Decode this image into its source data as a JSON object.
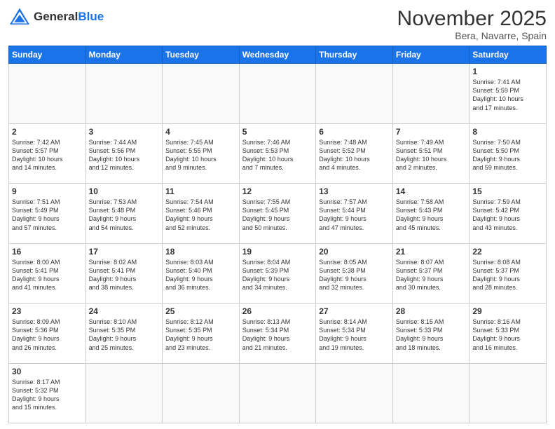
{
  "header": {
    "logo_general": "General",
    "logo_blue": "Blue",
    "month_title": "November 2025",
    "location": "Bera, Navarre, Spain"
  },
  "days_of_week": [
    "Sunday",
    "Monday",
    "Tuesday",
    "Wednesday",
    "Thursday",
    "Friday",
    "Saturday"
  ],
  "weeks": [
    [
      {
        "day": "",
        "text": ""
      },
      {
        "day": "",
        "text": ""
      },
      {
        "day": "",
        "text": ""
      },
      {
        "day": "",
        "text": ""
      },
      {
        "day": "",
        "text": ""
      },
      {
        "day": "",
        "text": ""
      },
      {
        "day": "1",
        "text": "Sunrise: 7:41 AM\nSunset: 5:59 PM\nDaylight: 10 hours\nand 17 minutes."
      }
    ],
    [
      {
        "day": "2",
        "text": "Sunrise: 7:42 AM\nSunset: 5:57 PM\nDaylight: 10 hours\nand 14 minutes."
      },
      {
        "day": "3",
        "text": "Sunrise: 7:44 AM\nSunset: 5:56 PM\nDaylight: 10 hours\nand 12 minutes."
      },
      {
        "day": "4",
        "text": "Sunrise: 7:45 AM\nSunset: 5:55 PM\nDaylight: 10 hours\nand 9 minutes."
      },
      {
        "day": "5",
        "text": "Sunrise: 7:46 AM\nSunset: 5:53 PM\nDaylight: 10 hours\nand 7 minutes."
      },
      {
        "day": "6",
        "text": "Sunrise: 7:48 AM\nSunset: 5:52 PM\nDaylight: 10 hours\nand 4 minutes."
      },
      {
        "day": "7",
        "text": "Sunrise: 7:49 AM\nSunset: 5:51 PM\nDaylight: 10 hours\nand 2 minutes."
      },
      {
        "day": "8",
        "text": "Sunrise: 7:50 AM\nSunset: 5:50 PM\nDaylight: 9 hours\nand 59 minutes."
      }
    ],
    [
      {
        "day": "9",
        "text": "Sunrise: 7:51 AM\nSunset: 5:49 PM\nDaylight: 9 hours\nand 57 minutes."
      },
      {
        "day": "10",
        "text": "Sunrise: 7:53 AM\nSunset: 5:48 PM\nDaylight: 9 hours\nand 54 minutes."
      },
      {
        "day": "11",
        "text": "Sunrise: 7:54 AM\nSunset: 5:46 PM\nDaylight: 9 hours\nand 52 minutes."
      },
      {
        "day": "12",
        "text": "Sunrise: 7:55 AM\nSunset: 5:45 PM\nDaylight: 9 hours\nand 50 minutes."
      },
      {
        "day": "13",
        "text": "Sunrise: 7:57 AM\nSunset: 5:44 PM\nDaylight: 9 hours\nand 47 minutes."
      },
      {
        "day": "14",
        "text": "Sunrise: 7:58 AM\nSunset: 5:43 PM\nDaylight: 9 hours\nand 45 minutes."
      },
      {
        "day": "15",
        "text": "Sunrise: 7:59 AM\nSunset: 5:42 PM\nDaylight: 9 hours\nand 43 minutes."
      }
    ],
    [
      {
        "day": "16",
        "text": "Sunrise: 8:00 AM\nSunset: 5:41 PM\nDaylight: 9 hours\nand 41 minutes."
      },
      {
        "day": "17",
        "text": "Sunrise: 8:02 AM\nSunset: 5:41 PM\nDaylight: 9 hours\nand 38 minutes."
      },
      {
        "day": "18",
        "text": "Sunrise: 8:03 AM\nSunset: 5:40 PM\nDaylight: 9 hours\nand 36 minutes."
      },
      {
        "day": "19",
        "text": "Sunrise: 8:04 AM\nSunset: 5:39 PM\nDaylight: 9 hours\nand 34 minutes."
      },
      {
        "day": "20",
        "text": "Sunrise: 8:05 AM\nSunset: 5:38 PM\nDaylight: 9 hours\nand 32 minutes."
      },
      {
        "day": "21",
        "text": "Sunrise: 8:07 AM\nSunset: 5:37 PM\nDaylight: 9 hours\nand 30 minutes."
      },
      {
        "day": "22",
        "text": "Sunrise: 8:08 AM\nSunset: 5:37 PM\nDaylight: 9 hours\nand 28 minutes."
      }
    ],
    [
      {
        "day": "23",
        "text": "Sunrise: 8:09 AM\nSunset: 5:36 PM\nDaylight: 9 hours\nand 26 minutes."
      },
      {
        "day": "24",
        "text": "Sunrise: 8:10 AM\nSunset: 5:35 PM\nDaylight: 9 hours\nand 25 minutes."
      },
      {
        "day": "25",
        "text": "Sunrise: 8:12 AM\nSunset: 5:35 PM\nDaylight: 9 hours\nand 23 minutes."
      },
      {
        "day": "26",
        "text": "Sunrise: 8:13 AM\nSunset: 5:34 PM\nDaylight: 9 hours\nand 21 minutes."
      },
      {
        "day": "27",
        "text": "Sunrise: 8:14 AM\nSunset: 5:34 PM\nDaylight: 9 hours\nand 19 minutes."
      },
      {
        "day": "28",
        "text": "Sunrise: 8:15 AM\nSunset: 5:33 PM\nDaylight: 9 hours\nand 18 minutes."
      },
      {
        "day": "29",
        "text": "Sunrise: 8:16 AM\nSunset: 5:33 PM\nDaylight: 9 hours\nand 16 minutes."
      }
    ],
    [
      {
        "day": "30",
        "text": "Sunrise: 8:17 AM\nSunset: 5:32 PM\nDaylight: 9 hours\nand 15 minutes."
      },
      {
        "day": "",
        "text": ""
      },
      {
        "day": "",
        "text": ""
      },
      {
        "day": "",
        "text": ""
      },
      {
        "day": "",
        "text": ""
      },
      {
        "day": "",
        "text": ""
      },
      {
        "day": "",
        "text": ""
      }
    ]
  ]
}
